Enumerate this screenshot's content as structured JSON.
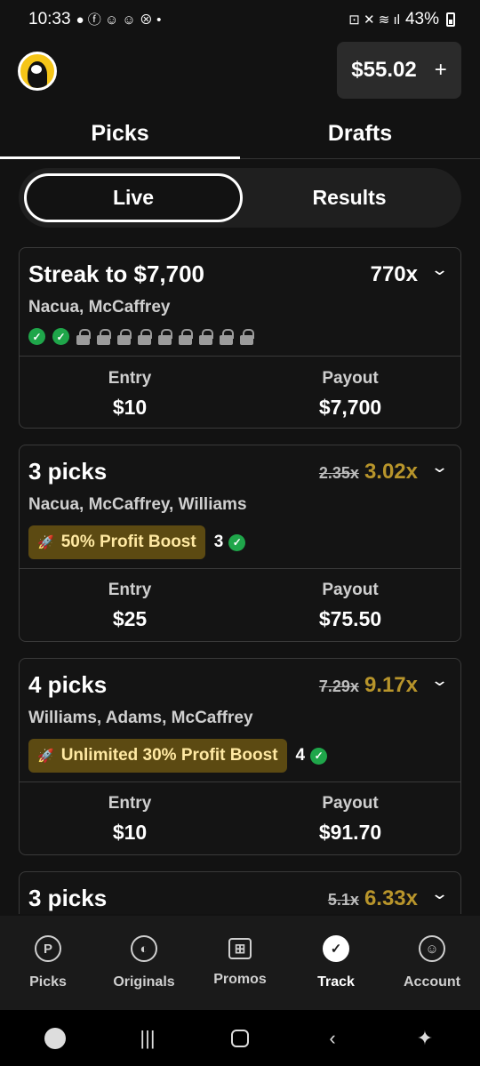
{
  "status": {
    "time": "10:33",
    "battery": "43%"
  },
  "header": {
    "balance": "$55.02",
    "add": "+"
  },
  "tabs": {
    "picks": "Picks",
    "drafts": "Drafts"
  },
  "segment": {
    "live": "Live",
    "results": "Results"
  },
  "cards": [
    {
      "title": "Streak to $7,700",
      "mult": "770x",
      "players": "Nacua, McCaffrey",
      "entry_label": "Entry",
      "entry": "$10",
      "payout_label": "Payout",
      "payout": "$7,700"
    },
    {
      "title": "3 picks",
      "old_mult": "2.35x",
      "new_mult": "3.02x",
      "players": "Nacua, McCaffrey, Williams",
      "boost": "50% Profit Boost",
      "count": "3",
      "entry_label": "Entry",
      "entry": "$25",
      "payout_label": "Payout",
      "payout": "$75.50"
    },
    {
      "title": "4 picks",
      "old_mult": "7.29x",
      "new_mult": "9.17x",
      "players": "Williams, Adams, McCaffrey",
      "boost": "Unlimited 30% Profit Boost",
      "count": "4",
      "entry_label": "Entry",
      "entry": "$10",
      "payout_label": "Payout",
      "payout": "$91.70"
    },
    {
      "title": "3 picks",
      "old_mult": "5.1x",
      "new_mult": "6.33x"
    }
  ],
  "nav": [
    {
      "label": "Picks",
      "icon": "p-icon"
    },
    {
      "label": "Originals",
      "icon": "originals-icon"
    },
    {
      "label": "Promos",
      "icon": "gift-icon"
    },
    {
      "label": "Track",
      "icon": "check-icon"
    },
    {
      "label": "Account",
      "icon": "account-icon"
    }
  ],
  "colors": {
    "accent_gold": "#b8952b",
    "boost_bg": "#5c4a12",
    "check_green": "#1fa64a"
  }
}
